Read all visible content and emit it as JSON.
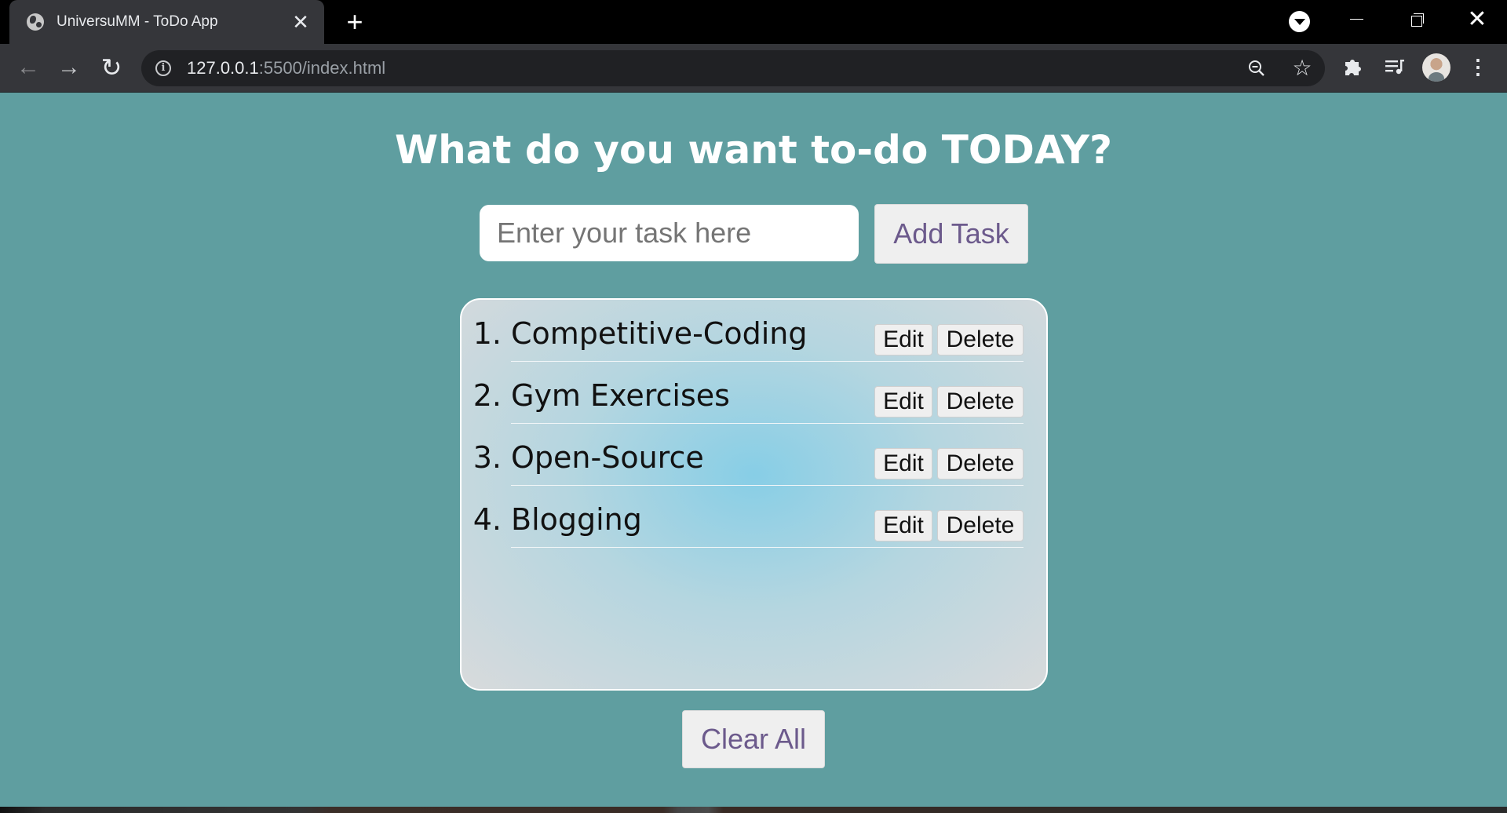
{
  "browser": {
    "tab_title": "UniversuMM - ToDo App",
    "tab_close": "✕",
    "new_tab": "+",
    "url_host": "127.0.0.1",
    "url_path": ":5500/index.html",
    "icons": {
      "favicon": "globe-icon",
      "back": "back-arrow-icon",
      "forward": "forward-arrow-icon",
      "reload": "reload-icon",
      "info": "info-icon",
      "zoom": "zoom-out-icon",
      "bookmark": "star-icon",
      "extensions": "puzzle-icon",
      "media": "media-queue-icon",
      "profile": "avatar",
      "menu": "kebab-menu-icon"
    },
    "glyphs": {
      "back": "←",
      "forward": "→",
      "reload": "↻",
      "info": "i",
      "star": "☆",
      "menu": "⋮",
      "minimize": "",
      "maximize": "",
      "close": "✕"
    }
  },
  "app": {
    "heading": "What do you want to-do TODAY?",
    "input_placeholder": "Enter your task here",
    "input_value": "",
    "add_button": "Add Task",
    "clear_button": "Clear All",
    "tasks": [
      {
        "number": "1.",
        "text": "Competitive-Coding",
        "edit": "Edit",
        "delete": "Delete"
      },
      {
        "number": "2.",
        "text": "Gym Exercises",
        "edit": "Edit",
        "delete": "Delete"
      },
      {
        "number": "3.",
        "text": "Open-Source",
        "edit": "Edit",
        "delete": "Delete"
      },
      {
        "number": "4.",
        "text": "Blogging",
        "edit": "Edit",
        "delete": "Delete"
      }
    ]
  },
  "colors": {
    "page_background": "#5f9ea0",
    "heading": "#ffffff",
    "button_text": "#6c5a8c",
    "list_center": "#87cee6"
  }
}
